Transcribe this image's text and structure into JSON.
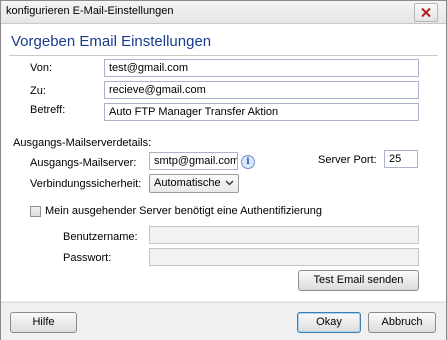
{
  "window": {
    "title": "konfigurieren E-Mail-Einstellungen"
  },
  "heading": "Vorgeben Email Einstellungen",
  "fields": {
    "von_label": "Von:",
    "von_value": "test@gmail.com",
    "zu_label": "Zu:",
    "zu_value": "recieve@gmail.com",
    "betreff_label": "Betreff:",
    "betreff_value": "Auto FTP Manager Transfer Aktion"
  },
  "server_section": {
    "title": "Ausgangs-Mailserverdetails:",
    "server_label": "Ausgangs-Mailserver:",
    "server_value": "smtp@gmail.com",
    "port_label": "Server Port:",
    "port_value": "25",
    "security_label": "Verbindungssicherheit:",
    "security_value": "Automatische",
    "auth_checkbox_label": "Mein ausgehender Server benötigt eine Authentifizierung",
    "auth_checked": false,
    "username_label": "Benutzername:",
    "username_value": "",
    "password_label": "Passwort:",
    "password_value": "",
    "test_button": "Test Email senden"
  },
  "footer": {
    "help_button": "Hilfe",
    "ok_button": "Okay",
    "cancel_button": "Abbruch"
  },
  "icons": {
    "close": "close-icon",
    "info": "info-icon",
    "chevron": "chevron-down-icon"
  }
}
